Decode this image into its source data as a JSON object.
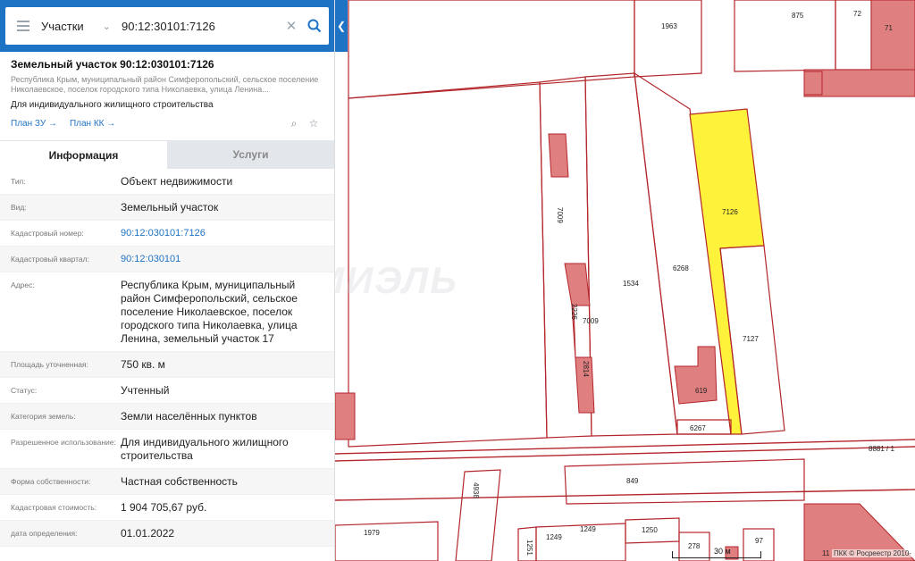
{
  "search": {
    "type_label": "Участки",
    "query": "90:12:30101:7126"
  },
  "object": {
    "title": "Земельный участок 90:12:030101:7126",
    "address_short": "Республика Крым, муниципальный район Симферопольский, сельское поселение Николаевское, поселок городского типа Николаевка, улица Ленина...",
    "use": "Для индивидуального жилищного строительства",
    "plan_zu": "План ЗУ",
    "plan_kk": "План КК"
  },
  "tabs": [
    "Информация",
    "Услуги"
  ],
  "info": [
    {
      "label": "Тип:",
      "value": "Объект недвижимости"
    },
    {
      "label": "Вид:",
      "value": "Земельный участок"
    },
    {
      "label": "Кадастровый номер:",
      "value": "90:12:030101:7126"
    },
    {
      "label": "Кадастровый квартал:",
      "value": "90:12:030101"
    },
    {
      "label": "Адрес:",
      "value": "Республика Крым, муниципальный район Симферопольский, сельское поселение Николаевское, поселок городского типа Николаевка, улица Ленина, земельный участок 17"
    },
    {
      "label": "Площадь уточненная:",
      "value": "750 кв. м"
    },
    {
      "label": "Статус:",
      "value": "Учтенный"
    },
    {
      "label": "Категория земель:",
      "value": "Земли населённых пунктов"
    },
    {
      "label": "Разрешенное использование:",
      "value": "Для индивидуального жилищного строительства"
    },
    {
      "label": "Форма собственности:",
      "value": "Частная собственность"
    },
    {
      "label": "Кадастровая стоимость:",
      "value": "1 904 705,67 руб."
    },
    {
      "label": "дата определения:",
      "value": "01.01.2022"
    }
  ],
  "map": {
    "labels": [
      "1963",
      "875",
      "72",
      "71",
      "7009",
      "7126",
      "6268",
      "2226",
      "7009",
      "1534",
      "7127",
      "2814",
      "619",
      "6267",
      "8881 / 1",
      "849",
      "4938",
      "1979",
      "1249",
      "1249",
      "1250",
      "1251",
      "278",
      "97",
      "11"
    ],
    "scale_label": "30 м",
    "copyright": "ПКК © Росреестр 2010-",
    "watermark": "МИЭЛЬ"
  },
  "colors": {
    "accent": "#1f73c4",
    "selected_parcel": "#fff23b",
    "building": "#e07f80",
    "boundary": "#b3262b"
  }
}
